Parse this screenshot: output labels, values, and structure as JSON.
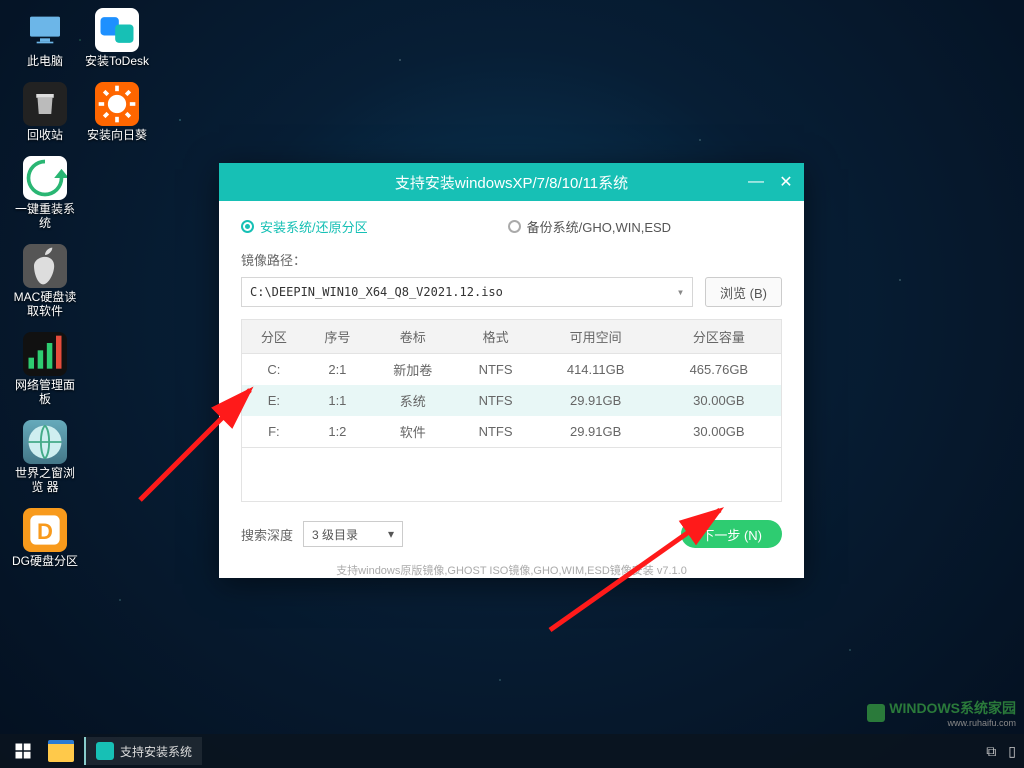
{
  "desktop_icons_col1": [
    {
      "label": "此电脑",
      "icon": "pc"
    },
    {
      "label": "回收站",
      "icon": "bin"
    },
    {
      "label": "一键重装系统",
      "icon": "reinstall"
    },
    {
      "label": "MAC硬盘读\n取软件",
      "icon": "mac"
    },
    {
      "label": "网络管理面板",
      "icon": "net"
    },
    {
      "label": "世界之窗浏览\n器",
      "icon": "browser"
    },
    {
      "label": "DG硬盘分区",
      "icon": "dg"
    }
  ],
  "desktop_icons_col2": [
    {
      "label": "安装ToDesk",
      "icon": "todesk"
    },
    {
      "label": "安装向日葵",
      "icon": "sun"
    }
  ],
  "window": {
    "title": "支持安装windowsXP/7/8/10/11系统",
    "radio_install": "安装系统/还原分区",
    "radio_backup": "备份系统/GHO,WIN,ESD",
    "path_label": "镜像路径：",
    "image_path": "C:\\DEEPIN_WIN10_X64_Q8_V2021.12.iso",
    "browse": "浏览 (B)",
    "columns": {
      "part": "分区",
      "idx": "序号",
      "label": "卷标",
      "fmt": "格式",
      "free": "可用空间",
      "cap": "分区容量"
    },
    "rows": [
      {
        "part": "C:",
        "idx": "2:1",
        "label": "新加卷",
        "fmt": "NTFS",
        "free": "414.11GB",
        "cap": "465.76GB",
        "sel": false
      },
      {
        "part": "E:",
        "idx": "1:1",
        "label": "系统",
        "fmt": "NTFS",
        "free": "29.91GB",
        "cap": "30.00GB",
        "sel": true
      },
      {
        "part": "F:",
        "idx": "1:2",
        "label": "软件",
        "fmt": "NTFS",
        "free": "29.91GB",
        "cap": "30.00GB",
        "sel": false
      }
    ],
    "depth_label": "搜索深度",
    "depth_value": "3 级目录",
    "next": "下一步 (N)",
    "support_text": "支持windows原版镜像,GHOST ISO镜像,GHO,WIM,ESD镜像安装 v7.1.0"
  },
  "taskbar": {
    "active_app": "支持安装系统"
  },
  "watermark": {
    "brand": "WINDOWS系统家园",
    "url": "www.ruhaifu.com"
  }
}
